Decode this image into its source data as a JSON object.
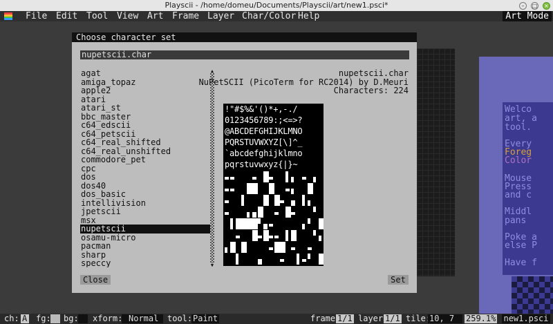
{
  "window": {
    "title": "Playscii - /home/domeu/Documents/Playscii/art/new1.psci*"
  },
  "menubar": {
    "items": [
      "File",
      "Edit",
      "Tool",
      "View",
      "Art",
      "Frame",
      "Layer",
      "Char/Color",
      "Help"
    ],
    "mode": "Art Mode"
  },
  "background_text": [
    "Welco",
    "art, a",
    "tool.",
    "Every",
    "Foreg",
    "Color",
    "Mouse",
    "Press",
    "and c",
    "Middl",
    "pans",
    "Poke a",
    "else P",
    "Have f"
  ],
  "dialog": {
    "title": "Choose character set",
    "filename": "nupetscii.char",
    "list": [
      "agat",
      "amiga_topaz",
      "apple2",
      "atari",
      "atari_st",
      "bbc_master",
      "c64_edscii",
      "c64_petscii",
      "c64_real_shifted",
      "c64_real_unshifted",
      "commodore_pet",
      "cpc",
      "dos",
      "dos40",
      "dos_basic",
      "intellivision",
      "jpetscii",
      "msx",
      "nupetscii",
      "osamu-micro",
      "pacman",
      "sharp",
      "speccy"
    ],
    "selected": "nupetscii",
    "info": {
      "file": "nupetscii.char",
      "description": "NuPetSCII (PicoTerm for RC2014) by D.Meuri",
      "characters": "Characters: 224"
    },
    "preview_rows": [
      " !\"#$%&'()*+,-./",
      "0123456789:;<=>?",
      "@ABCDEFGHIJKLMNO",
      "PQRSTUVWXYZ[\\]^_",
      "`abcdefghijklmno",
      "pqrstuvwxyz{|}~"
    ],
    "close_label": "Close",
    "set_label": "Set"
  },
  "statusbar": {
    "ch_label": "ch:",
    "ch_value": "A",
    "fg_label": "fg:",
    "bg_label": "bg:",
    "xform_label": "xform:",
    "xform_value": "Normal",
    "tool_label": "tool:",
    "tool_value": "Paint",
    "frame_label": "frame",
    "frame_value": "1/1",
    "layer_label": "layer",
    "layer_value": "1/1",
    "tile_label": "tile:",
    "tile_value": "10, 7",
    "zoom": "259.1%",
    "file": "new1.psci"
  },
  "colors": {
    "dialog_bg": "#bdbdbd",
    "purple": "#6a68b8",
    "purple_dark": "#3c3a90"
  }
}
